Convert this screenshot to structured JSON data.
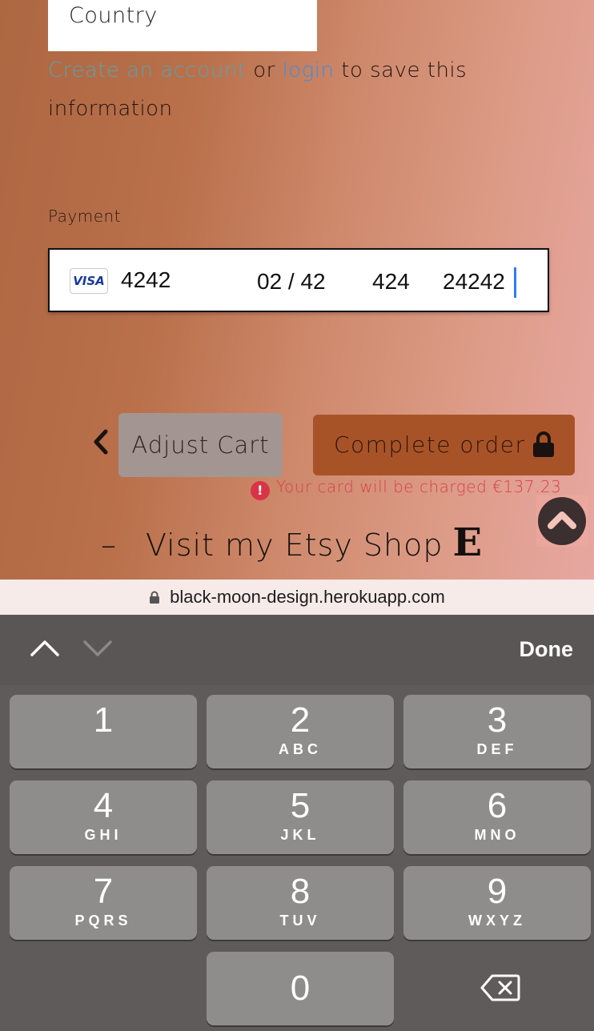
{
  "form": {
    "country_placeholder": "Country",
    "save_info": {
      "create_link": "Create an account",
      "or_text": "or",
      "login_link": "login",
      "suffix": "to save this information"
    },
    "payment_label": "Payment",
    "card": {
      "brand": "VISA",
      "number": "4242",
      "expiry": "02 / 42",
      "cvc": "424",
      "zip": "24242"
    }
  },
  "actions": {
    "adjust_cart": "Adjust Cart",
    "complete_order": "Complete order",
    "charge_note": "Your card will be charged €137.23"
  },
  "footer": {
    "dash": "–",
    "etsy_text": "Visit my Etsy Shop",
    "etsy_logo": "E"
  },
  "browser": {
    "url": "black-moon-design.herokuapp.com"
  },
  "keyboard": {
    "done": "Done",
    "keys": [
      {
        "num": "1",
        "letters": ""
      },
      {
        "num": "2",
        "letters": "ABC"
      },
      {
        "num": "3",
        "letters": "DEF"
      },
      {
        "num": "4",
        "letters": "GHI"
      },
      {
        "num": "5",
        "letters": "JKL"
      },
      {
        "num": "6",
        "letters": "MNO"
      },
      {
        "num": "7",
        "letters": "PQRS"
      },
      {
        "num": "8",
        "letters": "TUV"
      },
      {
        "num": "9",
        "letters": "WXYZ"
      },
      {
        "num": "0",
        "letters": ""
      }
    ]
  },
  "colors": {
    "complete_button": "#a85327",
    "adjust_button": "#a39592",
    "error_text": "#d8404e",
    "link_create": "#5aa1ad",
    "link_login": "#3e8fe0"
  }
}
